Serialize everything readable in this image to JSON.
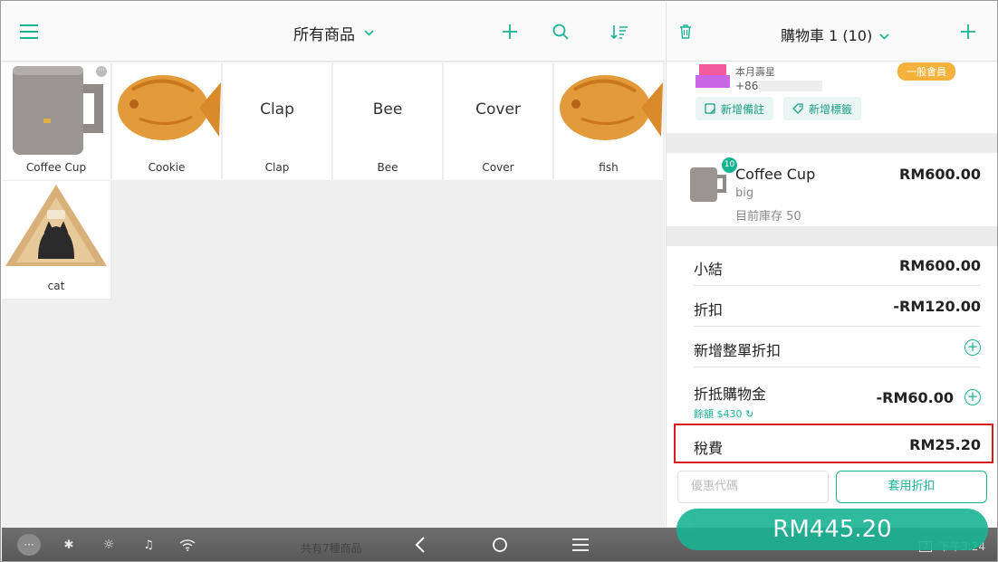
{
  "left_header": {
    "category_title": "所有商品"
  },
  "products": [
    {
      "name": "Coffee Cup",
      "image": "mug"
    },
    {
      "name": "Cookie",
      "image": "taiyaki"
    },
    {
      "name": "Clap",
      "display_text": "Clap"
    },
    {
      "name": "Bee",
      "display_text": "Bee"
    },
    {
      "name": "Cover",
      "display_text": "Cover"
    },
    {
      "name": "fish",
      "image": "taiyaki"
    },
    {
      "name": "cat",
      "image": "cat-house"
    }
  ],
  "product_count_text": "共有7種商品",
  "cart": {
    "title": "購物車 1 (10)",
    "member": {
      "name": "本月壽星",
      "phone_prefix": "+86",
      "tier": "一般會員"
    },
    "chips": {
      "add_note": "新增備註",
      "add_tag": "新增標籤"
    },
    "item": {
      "name": "Coffee Cup",
      "variant": "big",
      "stock": "目前庫存 50",
      "price": "RM600.00",
      "qty": "10"
    },
    "summary": {
      "subtotal_label": "小結",
      "subtotal_value": "RM600.00",
      "discount_label": "折扣",
      "discount_value": "-RM120.00",
      "add_order_discount_label": "新增整單折扣",
      "credit_label": "折抵購物金",
      "credit_value": "-RM60.00",
      "credit_balance": "餘額 $430",
      "tax_label": "稅費",
      "tax_value": "RM25.20"
    },
    "promo_placeholder": "優惠代碼",
    "apply_discount": "套用折扣",
    "checkout_total": "RM445.20"
  },
  "status_bar": {
    "time": "下午3:24",
    "screen_badge": "2"
  },
  "colors": {
    "accent": "#19b394",
    "highlight_border": "#d91d1d",
    "tier_badge": "#f4b23c"
  }
}
